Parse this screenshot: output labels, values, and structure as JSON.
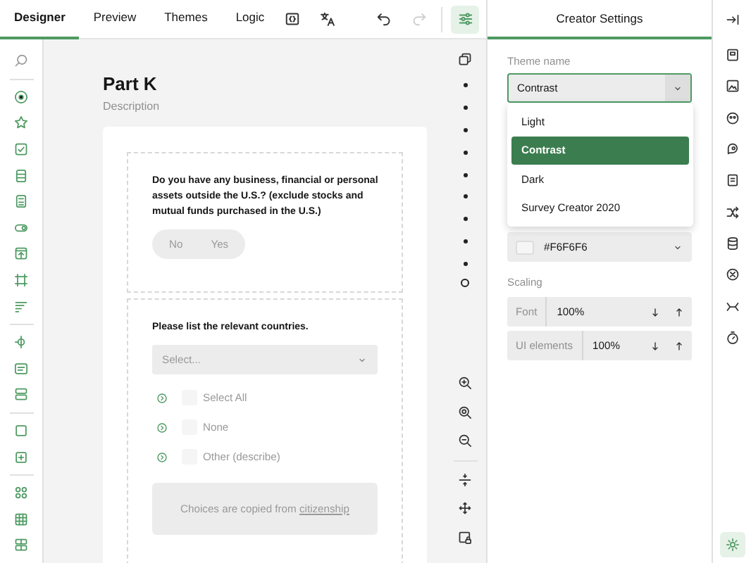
{
  "top_bar": {
    "tabs": [
      {
        "label": "Designer",
        "selected": true
      },
      {
        "label": "Preview",
        "selected": false
      },
      {
        "label": "Themes",
        "selected": false
      },
      {
        "label": "Logic",
        "selected": false
      }
    ]
  },
  "survey": {
    "title": "Part K",
    "description": "Description",
    "questions": [
      {
        "kind": "boolean",
        "title": "Do you have any business, financial or personal assets outside the U.S.? (exclude stocks and mutual funds purchased in the U.S.)",
        "options": [
          {
            "label": "No",
            "selected": false
          },
          {
            "label": "Yes",
            "selected": false
          }
        ]
      },
      {
        "kind": "checkbox",
        "title": "Please list the relevant countries.",
        "placeholder": "Select...",
        "choices": [
          {
            "label": "Select All",
            "checked": false
          },
          {
            "label": "None",
            "checked": false
          },
          {
            "label": "Other (describe)",
            "checked": false
          }
        ],
        "note": "Choices are copied from ",
        "note_link": "citizenship"
      }
    ]
  },
  "settings_panel": {
    "title": "Creator Settings",
    "theme_label": "Theme name",
    "theme_value": "Contrast",
    "theme_options": [
      {
        "label": "Light",
        "selected": false
      },
      {
        "label": "Contrast",
        "selected": true
      },
      {
        "label": "Dark",
        "selected": false
      },
      {
        "label": "Survey Creator 2020",
        "selected": false
      }
    ],
    "color_value": "#F6F6F6",
    "scaling_label": "Scaling",
    "scaling_rows": [
      {
        "label": "Font",
        "value": "100%"
      },
      {
        "label": "UI elements",
        "value": "100%"
      }
    ]
  }
}
